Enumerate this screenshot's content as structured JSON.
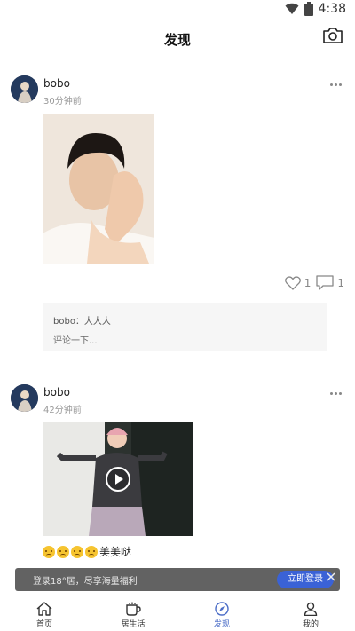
{
  "status": {
    "time": "4:38"
  },
  "header": {
    "title": "发现"
  },
  "posts": [
    {
      "username": "bobo",
      "time": "30分钟前",
      "likes": "1",
      "comments": "1",
      "comment": "bobo：大大大",
      "comment_placeholder": "评论一下..."
    },
    {
      "username": "bobo",
      "time": "42分钟前",
      "caption": "美美哒"
    }
  ],
  "toast": {
    "text": "登录18°居，尽享海量福利",
    "login_label": "立即登录"
  },
  "tabs": [
    {
      "label": "首页",
      "icon": "home-icon"
    },
    {
      "label": "居生活",
      "icon": "cup-icon"
    },
    {
      "label": "发现",
      "icon": "compass-icon",
      "active": true
    },
    {
      "label": "我的",
      "icon": "user-icon"
    }
  ],
  "colors": {
    "accent": "#4a6cc7",
    "login_button": "#3a62d6"
  }
}
